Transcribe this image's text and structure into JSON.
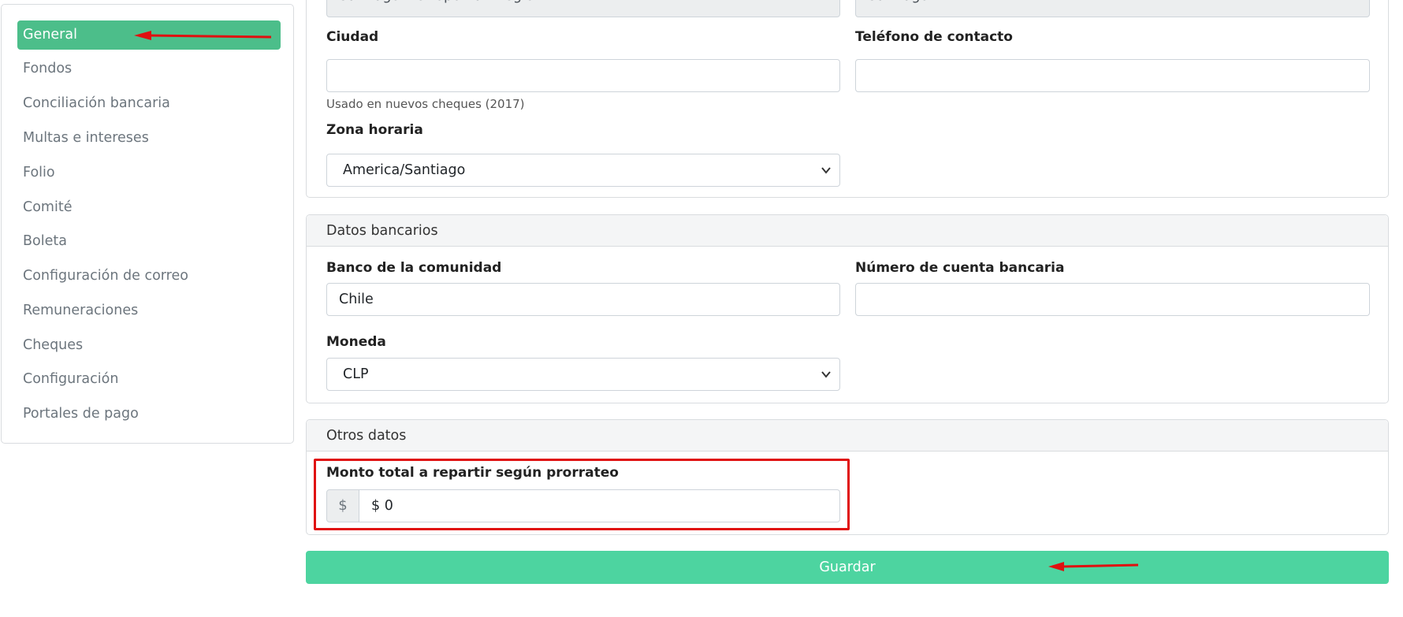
{
  "sidebar": {
    "items": [
      {
        "label": "General",
        "active": true
      },
      {
        "label": "Fondos"
      },
      {
        "label": "Conciliación bancaria"
      },
      {
        "label": "Multas e intereses"
      },
      {
        "label": "Folio"
      },
      {
        "label": "Comité"
      },
      {
        "label": "Boleta"
      },
      {
        "label": "Configuración de correo"
      },
      {
        "label": "Remuneraciones"
      },
      {
        "label": "Cheques"
      },
      {
        "label": "Configuración"
      },
      {
        "label": "Portales de pago"
      }
    ]
  },
  "general_panel": {
    "region_value": "Santiago Metropolitan Region",
    "comuna_value": "Santiago",
    "city_label": "Ciudad",
    "city_value": "",
    "city_help": "Usado en nuevos cheques (2017)",
    "phone_label": "Teléfono de contacto",
    "phone_value": "",
    "timezone_label": "Zona horaria",
    "timezone_value": "America/Santiago"
  },
  "bank_panel": {
    "header": "Datos bancarios",
    "bank_label": "Banco de la comunidad",
    "bank_value": "Chile",
    "account_label": "Número de cuenta bancaria",
    "account_value": "",
    "currency_label": "Moneda",
    "currency_value": "CLP"
  },
  "other_panel": {
    "header": "Otros datos",
    "amount_label": "Monto total a repartir según prorrateo",
    "amount_prefix": "$",
    "amount_value": "$ 0"
  },
  "save_label": "Guardar",
  "colors": {
    "active_sidebar": "#4cbe8a",
    "save_button": "#4dd4a0",
    "annotation": "#e01010"
  }
}
